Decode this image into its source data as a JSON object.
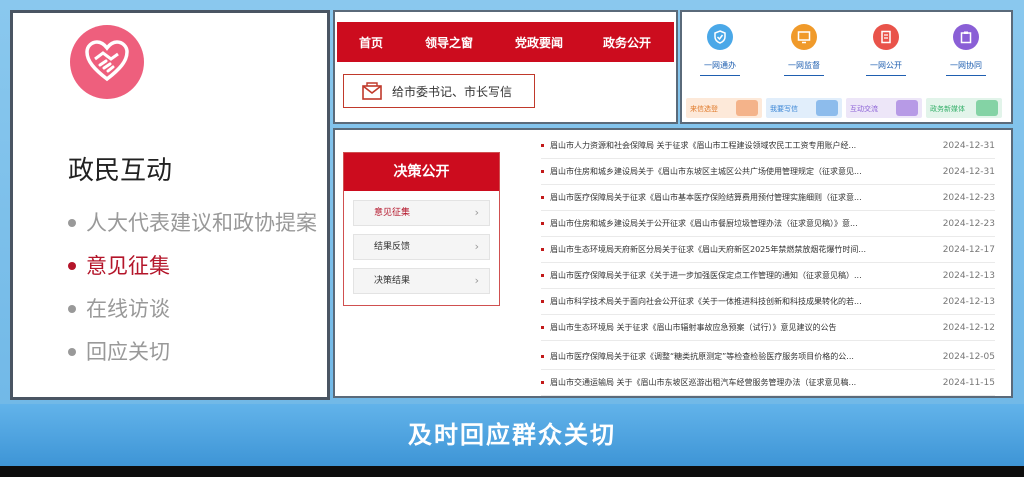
{
  "left_panel": {
    "title": "政民互动",
    "menu": [
      {
        "label": "人大代表建议和政协提案",
        "active": false
      },
      {
        "label": "意见征集",
        "active": true
      },
      {
        "label": "在线访谈",
        "active": false
      },
      {
        "label": "回应关切",
        "active": false
      }
    ],
    "logo_icon": "heart-handshake-icon"
  },
  "top_nav": {
    "items": [
      "首页",
      "领导之窗",
      "党政要闻",
      "政务公开"
    ],
    "letter_button": "给市委书记、市长写信",
    "accent": "#cc0c1e"
  },
  "quick_links": {
    "icons": [
      {
        "label": "一网通办",
        "color": "#4aa8e8"
      },
      {
        "label": "一网监督",
        "color": "#f09a2a"
      },
      {
        "label": "一网公开",
        "color": "#e9534a"
      },
      {
        "label": "一网协同",
        "color": "#8a5fd6"
      }
    ],
    "tiles": [
      {
        "label": "来信选登",
        "bg": "#fde9d9",
        "color": "#e07a2a"
      },
      {
        "label": "我要写信",
        "bg": "#e1eefb",
        "color": "#3b86d6"
      },
      {
        "label": "互动交流",
        "bg": "#ede6f8",
        "color": "#8a5fd6"
      },
      {
        "label": "政务新媒体",
        "bg": "#e2f4ea",
        "color": "#35b06a"
      }
    ]
  },
  "juece": {
    "title": "决策公开",
    "items": [
      {
        "label": "意见征集",
        "active": true
      },
      {
        "label": "结果反馈",
        "active": false
      },
      {
        "label": "决策结果",
        "active": false
      }
    ]
  },
  "news": [
    {
      "title": "眉山市人力资源和社会保障局 关于征求《眉山市工程建设领域农民工工资专用账户经...",
      "date": "2024-12-31"
    },
    {
      "title": "眉山市住房和城乡建设局关于《眉山市东坡区主城区公共广场使用管理规定（征求意见...",
      "date": "2024-12-31"
    },
    {
      "title": "眉山市医疗保障局关于征求《眉山市基本医疗保险结算费用预付管理实施细则（征求意...",
      "date": "2024-12-23"
    },
    {
      "title": "眉山市住房和城乡建设局关于公开征求《眉山市餐厨垃圾管理办法（征求意见稿）》意...",
      "date": "2024-12-23"
    },
    {
      "title": "眉山市生态环境局天府新区分局关于征求《眉山天府新区2025年禁燃禁放烟花爆竹时间...",
      "date": "2024-12-17"
    },
    {
      "title": "眉山市医疗保障局关于征求《关于进一步加强医保定点工作管理的通知（征求意见稿）...",
      "date": "2024-12-13"
    },
    {
      "title": "眉山市科学技术局关于面向社会公开征求《关于一体推进科技创新和科技成果转化的若...",
      "date": "2024-12-13"
    },
    {
      "title": "眉山市生态环境局 关于征求《眉山市辐射事故应急预案（试行）》意见建议的公告",
      "date": "2024-12-12"
    },
    {
      "title": "眉山市医疗保障局关于征求《调整“糖类抗原测定”等检查检验医疗服务项目价格的公...",
      "date": "2024-12-05"
    },
    {
      "title": "眉山市交通运输局 关于《眉山市东坡区巡游出租汽车经营服务管理办法（征求意见稿...",
      "date": "2024-11-15"
    }
  ],
  "banner": {
    "text": "及时回应群众关切",
    "color": "#3e95d6"
  }
}
